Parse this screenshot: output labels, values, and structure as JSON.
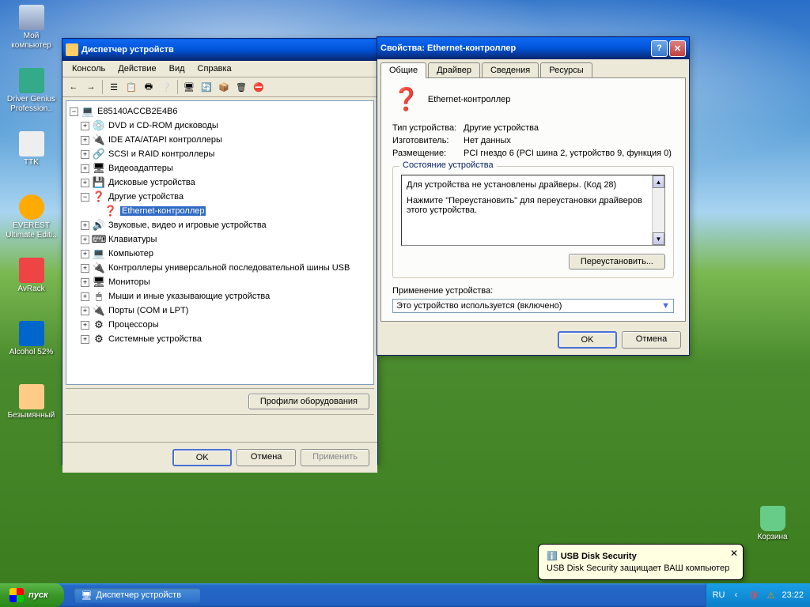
{
  "desktop": {
    "icons": [
      {
        "label": "Мой\nкомпьютер"
      },
      {
        "label": "Driver Genius\nProfession.."
      },
      {
        "label": "TTK"
      },
      {
        "label": "EVEREST\nUltimate Editi.."
      },
      {
        "label": "AvRack"
      },
      {
        "label": "Alcohol 52%"
      },
      {
        "label": "Безымянный"
      }
    ],
    "recycle": "Корзина"
  },
  "devmgr": {
    "title": "Диспетчер устройств",
    "menu": [
      "Консоль",
      "Действие",
      "Вид",
      "Справка"
    ],
    "root": "E85140ACCB2E4B6",
    "items": [
      {
        "t": "DVD и CD-ROM дисководы",
        "e": "+",
        "i": "💿"
      },
      {
        "t": "IDE ATA/ATAPI контроллеры",
        "e": "+",
        "i": "🔌"
      },
      {
        "t": "SCSI и RAID контроллеры",
        "e": "+",
        "i": "🔗"
      },
      {
        "t": "Видеоадаптеры",
        "e": "+",
        "i": "🖥"
      },
      {
        "t": "Дисковые устройства",
        "e": "+",
        "i": "💾"
      },
      {
        "t": "Другие устройства",
        "e": "−",
        "i": "❓",
        "open": true
      },
      {
        "t": "Звуковые, видео и игровые устройства",
        "e": "+",
        "i": "🔊"
      },
      {
        "t": "Клавиатуры",
        "e": "+",
        "i": "⌨"
      },
      {
        "t": "Компьютер",
        "e": "+",
        "i": "💻"
      },
      {
        "t": "Контроллеры универсальной последовательной шины USB",
        "e": "+",
        "i": "🔌"
      },
      {
        "t": "Мониторы",
        "e": "+",
        "i": "🖥"
      },
      {
        "t": "Мыши и иные указывающие устройства",
        "e": "+",
        "i": "🖱"
      },
      {
        "t": "Порты (COM и LPT)",
        "e": "+",
        "i": "🔌"
      },
      {
        "t": "Процессоры",
        "e": "+",
        "i": "⚙"
      },
      {
        "t": "Системные устройства",
        "e": "+",
        "i": "⚙"
      }
    ],
    "child": "Ethernet-контроллер",
    "hw_profiles": "Профили оборудования",
    "ok": "OK",
    "cancel": "Отмена",
    "apply": "Применить"
  },
  "props": {
    "title": "Свойства: Ethernet-контроллер",
    "tabs": [
      "Общие",
      "Драйвер",
      "Сведения",
      "Ресурсы"
    ],
    "dev_name": "Ethernet-контроллер",
    "rows": [
      {
        "l": "Тип устройства:",
        "v": "Другие устройства"
      },
      {
        "l": "Изготовитель:",
        "v": "Нет данных"
      },
      {
        "l": "Размещение:",
        "v": "PCI гнездо 6 (PCI шина 2, устройство 9, функция 0)"
      }
    ],
    "status_legend": "Состояние устройства",
    "status_text1": "Для устройства не установлены драйверы. (Код 28)",
    "status_text2": "Нажмите \"Переустановить\" для переустановки драйверов этого устройства.",
    "reinstall": "Переустановить...",
    "usage_label": "Применение устройства:",
    "usage_value": "Это устройство используется (включено)",
    "ok": "OK",
    "cancel": "Отмена"
  },
  "balloon": {
    "title": "USB Disk Security",
    "text": "USB Disk Security защищает ВАШ компьютер"
  },
  "taskbar": {
    "start": "пуск",
    "task": "Диспетчер устройств",
    "lang": "RU",
    "clock": "23:22"
  }
}
